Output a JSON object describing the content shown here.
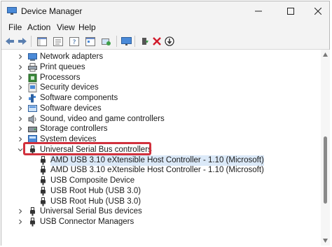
{
  "window": {
    "title": "Device Manager"
  },
  "menu": [
    "File",
    "Action",
    "View",
    "Help"
  ],
  "tree": [
    {
      "label": "Network adapters",
      "icon": "network-adapter-icon"
    },
    {
      "label": "Print queues",
      "icon": "printer-icon"
    },
    {
      "label": "Processors",
      "icon": "processor-icon"
    },
    {
      "label": "Security devices",
      "icon": "security-device-icon"
    },
    {
      "label": "Software components",
      "icon": "software-component-icon"
    },
    {
      "label": "Software devices",
      "icon": "software-device-icon"
    },
    {
      "label": "Sound, video and game controllers",
      "icon": "sound-icon"
    },
    {
      "label": "Storage controllers",
      "icon": "storage-icon"
    },
    {
      "label": "System devices",
      "icon": "system-device-icon"
    },
    {
      "label": "Universal Serial Bus controllers",
      "icon": "usb-icon",
      "expanded": true
    },
    {
      "label": "AMD USB 3.10 eXtensible Host Controller - 1.10 (Microsoft)",
      "icon": "usb-icon",
      "selected": true
    },
    {
      "label": "AMD USB 3.10 eXtensible Host Controller - 1.10 (Microsoft)",
      "icon": "usb-icon"
    },
    {
      "label": "USB Composite Device",
      "icon": "usb-icon"
    },
    {
      "label": "USB Root Hub (USB 3.0)",
      "icon": "usb-icon"
    },
    {
      "label": "USB Root Hub (USB 3.0)",
      "icon": "usb-icon"
    },
    {
      "label": "Universal Serial Bus devices",
      "icon": "usb-icon"
    },
    {
      "label": "USB Connector Managers",
      "icon": "usb-icon"
    }
  ],
  "colors": {
    "highlight": "#d1313d",
    "selection": "#dbe9f8",
    "chrome": "#f3f3f3"
  }
}
